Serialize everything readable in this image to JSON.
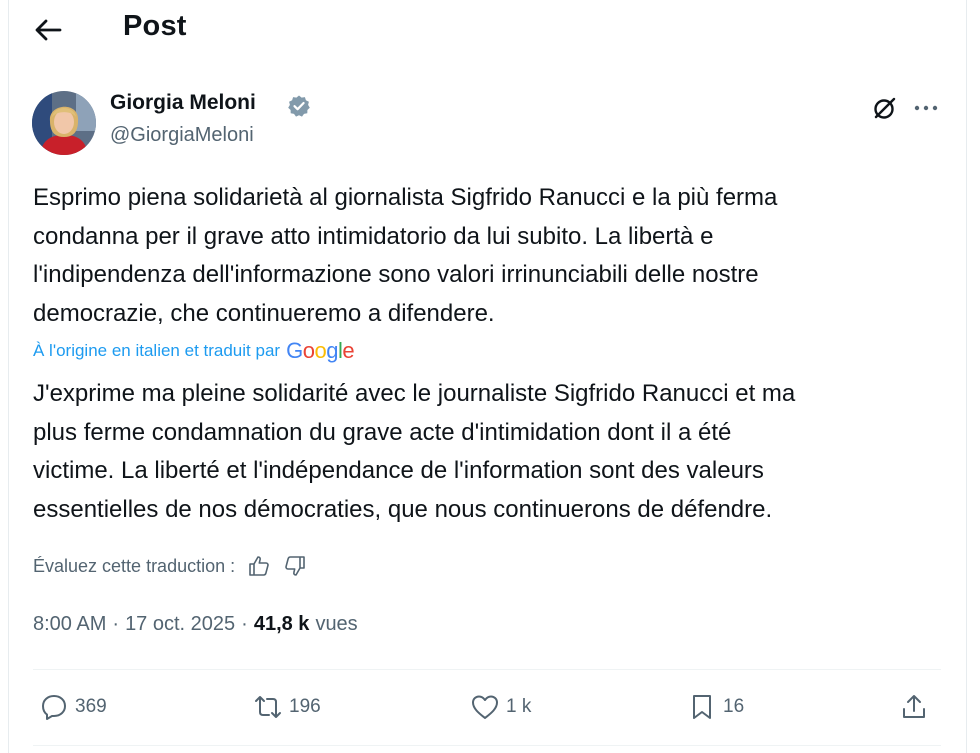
{
  "header": {
    "title": "Post",
    "back_icon": "arrow-left-icon"
  },
  "author": {
    "name": "Giorgia Meloni",
    "handle": "@GiorgiaMeloni",
    "verified_color": "#829aab"
  },
  "post": {
    "text_lines": [
      "Esprimo piena solidarietà al giornalista Sigfrido Ranucci e la più ferma",
      "condanna per il grave atto intimidatorio da lui subito. La libertà e",
      "l'indipendenza dell'informazione sono valori irrinunciabili delle nostre",
      "democrazie, che continueremo a difendere."
    ],
    "translated_label": "À l'origine en italien et traduit par",
    "translator": "Google",
    "translation_lines": [
      "J'exprime ma pleine solidarité avec le journaliste Sigfrido Ranucci et ma",
      "plus ferme condamnation du grave acte d'intimidation dont il a été",
      "victime. La liberté et l'indépendance de l'information sont des valeurs",
      "essentielles de nos démocraties, que nous continuerons de défendre."
    ],
    "rate_label": "Évaluez cette traduction :",
    "time": "8:00 AM",
    "date": "17 oct. 2025",
    "separator": "·",
    "views_count": "41,8 k",
    "views_label": "vues"
  },
  "actions": {
    "replies": "369",
    "reposts": "196",
    "likes": "1 k",
    "bookmarks": "16"
  },
  "colors": {
    "accent": "#1d9bf0",
    "secondary_text": "#536471",
    "text": "#0f1419"
  }
}
